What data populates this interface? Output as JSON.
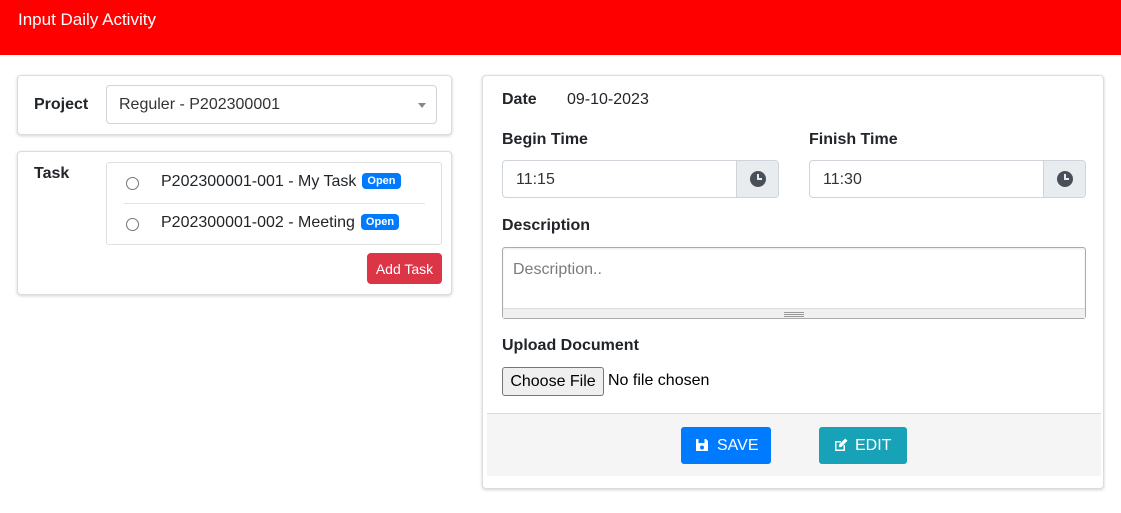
{
  "header": {
    "title": "Input Daily Activity"
  },
  "project": {
    "label": "Project",
    "selected": "Reguler - P202300001"
  },
  "task": {
    "label": "Task",
    "items": [
      {
        "name": "P202300001-001 - My Task",
        "status": "Open"
      },
      {
        "name": "P202300001-002 - Meeting",
        "status": "Open"
      }
    ],
    "add_button": "Add Task"
  },
  "form": {
    "date_label": "Date",
    "date_value": "09-10-2023",
    "begin_label": "Begin Time",
    "begin_value": "11:15",
    "finish_label": "Finish Time",
    "finish_value": "11:30",
    "description_label": "Description",
    "description_placeholder": "Description..",
    "upload_label": "Upload Document",
    "file_button": "Choose File",
    "file_status": "No file chosen",
    "save_label": "SAVE",
    "edit_label": "EDIT"
  },
  "icons": {
    "clock": "clock-icon",
    "save": "floppy-disk-icon",
    "edit": "edit-icon",
    "dropdown": "caret-down-icon"
  },
  "colors": {
    "header": "#ff0000",
    "badge": "#007bff",
    "add_task": "#dc3545",
    "save": "#007bff",
    "edit": "#17a2b8"
  }
}
